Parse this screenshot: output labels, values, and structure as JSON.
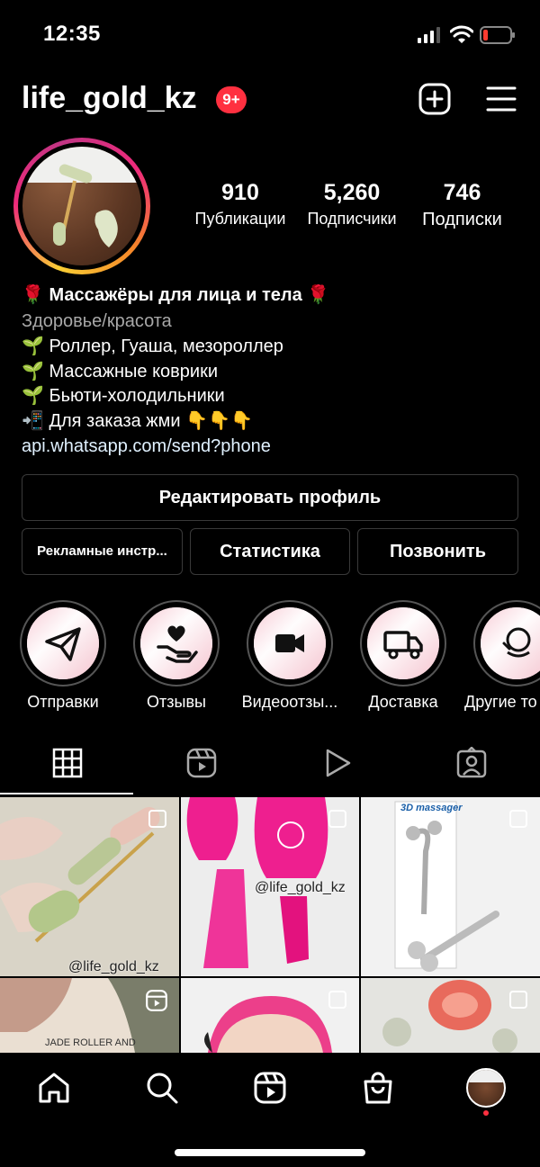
{
  "status": {
    "time": "12:35"
  },
  "header": {
    "username": "life_gold_kz",
    "badge": "9+"
  },
  "stats": [
    {
      "value": "910",
      "label": "Публикации"
    },
    {
      "value": "5,260",
      "label": "Подписчики"
    },
    {
      "value": "746",
      "label": "Подписки"
    }
  ],
  "bio": {
    "title": "🌹 Массажёры для лица и тела 🌹",
    "category": "Здоровье/красота",
    "lines": [
      "🌱 Роллер, Гуаша, мезороллер",
      "🌱 Массажные коврики",
      "🌱 Бьюти-холодильники",
      "📲 Для заказа жми 👇👇👇"
    ],
    "link": "api.whatsapp.com/send?phone"
  },
  "buttons": {
    "edit": "Редактировать профиль",
    "ads": "Рекламные инстр...",
    "stats": "Статистика",
    "call": "Позвонить"
  },
  "highlights": [
    {
      "label": "Отправки",
      "icon": "paper-plane-icon"
    },
    {
      "label": "Отзывы",
      "icon": "heart-hand-icon"
    },
    {
      "label": "Видеоотзы...",
      "icon": "video-camera-icon"
    },
    {
      "label": "Доставка",
      "icon": "truck-icon"
    },
    {
      "label": "Другие то",
      "icon": "face-massage-icon"
    }
  ],
  "posts": {
    "watermark1": "@life_gold_kz",
    "watermark2": "@life_gold_kz",
    "box_title": "3D massager",
    "jade_text": "JADE ROLLER AND"
  },
  "colors": {
    "accent_badge": "#ff3040",
    "link": "#e0f1ff",
    "pink": "#ee1f8f"
  }
}
